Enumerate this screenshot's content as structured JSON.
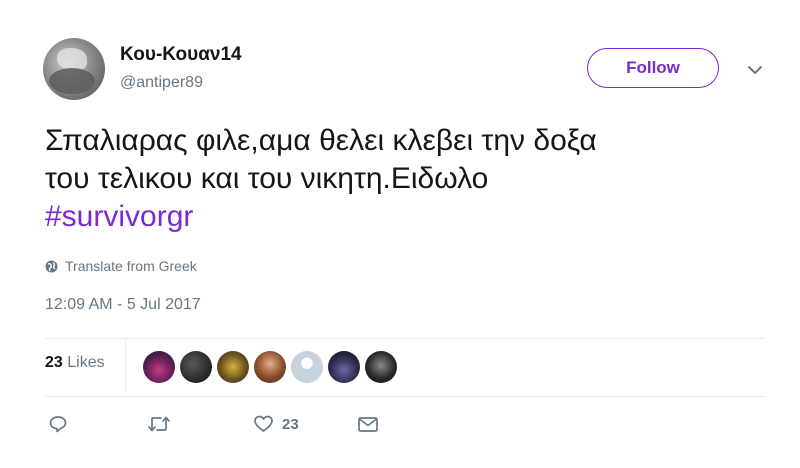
{
  "tweet": {
    "author_name": "Κου-Κουαν14",
    "author_handle": "@antiper89",
    "follow_label": "Follow",
    "text_line1": "Σπαλιαρας φιλε,αμα θελει κλεβει την δοξα",
    "text_line2": "του τελικου και του νικητη.Ειδωλο",
    "hashtag": "#survivorgr",
    "translate_label": "Translate from Greek",
    "timestamp": "12:09 AM - 5 Jul 2017",
    "likes_count": "23",
    "likes_label": "Likes",
    "like_action_count": "23"
  },
  "colors": {
    "accent": "#7b2ad1",
    "muted": "#657786",
    "text": "#14171a",
    "divider": "#e6ecf0"
  },
  "icons": [
    "globe-icon",
    "chevron-down-icon",
    "reply-icon",
    "retweet-icon",
    "heart-icon",
    "message-icon"
  ]
}
